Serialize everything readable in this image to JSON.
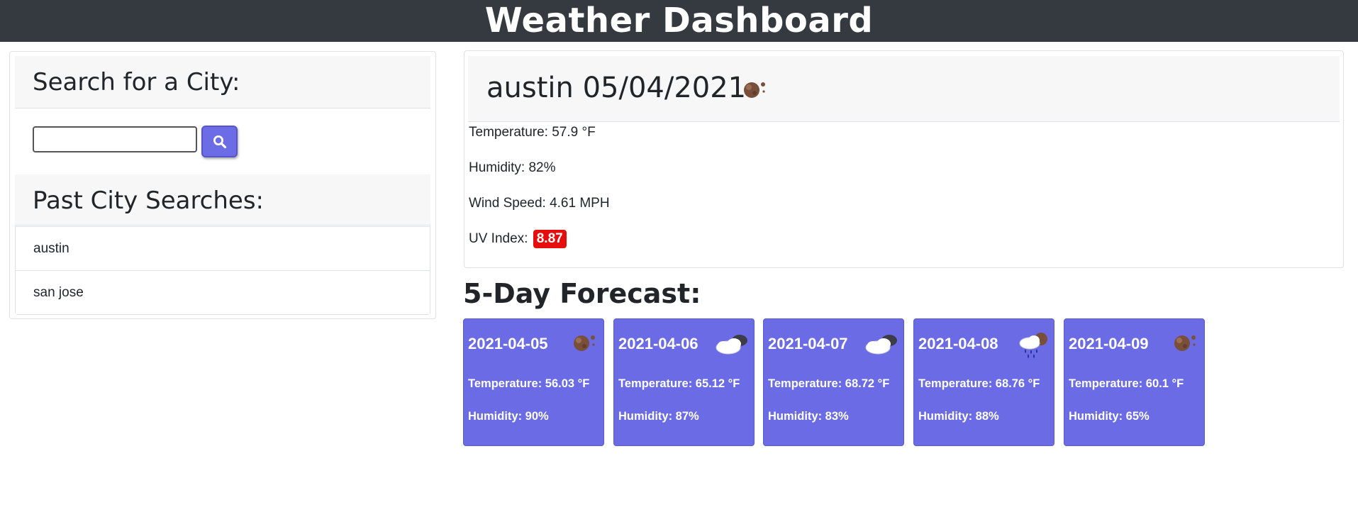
{
  "header": {
    "title": "Weather Dashboard"
  },
  "search": {
    "heading": "Search for a City:",
    "value": "",
    "button_icon": "search-icon"
  },
  "past": {
    "heading": "Past City Searches:",
    "items": [
      {
        "label": "austin"
      },
      {
        "label": "san jose"
      }
    ]
  },
  "current": {
    "title": "austin 05/04/2021",
    "icon": "clear-night-icon",
    "temperature": "Temperature: 57.9 °F",
    "humidity": "Humidity: 82%",
    "wind": "Wind Speed: 4.61 MPH",
    "uv_label": "UV Index:",
    "uv_value": "8.87",
    "uv_color": "#e60d0d"
  },
  "forecast": {
    "title": "5-Day Forecast:",
    "card_color": "#6b6be6",
    "days": [
      {
        "date": "2021-04-05",
        "icon": "clear-night-icon",
        "temp": "Temperature: 56.03 °F",
        "humidity": "Humidity: 90%"
      },
      {
        "date": "2021-04-06",
        "icon": "cloudy-night-icon",
        "temp": "Temperature: 65.12 °F",
        "humidity": "Humidity: 87%"
      },
      {
        "date": "2021-04-07",
        "icon": "cloudy-night-icon",
        "temp": "Temperature: 68.72 °F",
        "humidity": "Humidity: 83%"
      },
      {
        "date": "2021-04-08",
        "icon": "rain-night-icon",
        "temp": "Temperature: 68.76 °F",
        "humidity": "Humidity: 88%"
      },
      {
        "date": "2021-04-09",
        "icon": "clear-night-icon",
        "temp": "Temperature: 60.1 °F",
        "humidity": "Humidity: 65%"
      }
    ]
  }
}
